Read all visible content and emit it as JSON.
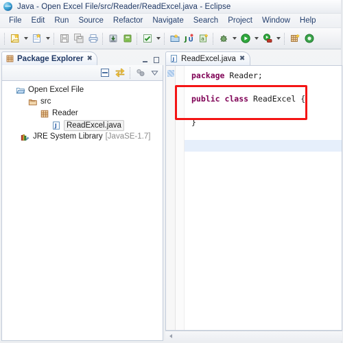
{
  "window": {
    "title": "Java - Open Excel File/src/Reader/ReadExcel.java - Eclipse",
    "app_icon": "eclipse-ball-icon"
  },
  "menubar": {
    "items": [
      {
        "label": "File"
      },
      {
        "label": "Edit"
      },
      {
        "label": "Run"
      },
      {
        "label": "Source"
      },
      {
        "label": "Refactor"
      },
      {
        "label": "Navigate"
      },
      {
        "label": "Search"
      },
      {
        "label": "Project"
      },
      {
        "label": "Window"
      },
      {
        "label": "Help"
      }
    ]
  },
  "toolbar": {
    "groups": [
      {
        "buttons": [
          {
            "name": "new-wizard-icon",
            "dropdown": true
          },
          {
            "name": "new-java-class-icon",
            "dropdown": true
          }
        ]
      },
      {
        "buttons": [
          {
            "name": "save-icon",
            "dropdown": false
          },
          {
            "name": "save-all-icon",
            "dropdown": false
          },
          {
            "name": "print-icon",
            "dropdown": false
          }
        ]
      },
      {
        "buttons": [
          {
            "name": "import-icon",
            "dropdown": false
          },
          {
            "name": "export-icon",
            "dropdown": false
          }
        ]
      },
      {
        "buttons": [
          {
            "name": "build-all-icon",
            "dropdown": true
          }
        ]
      },
      {
        "buttons": [
          {
            "name": "open-type-icon",
            "dropdown": false
          },
          {
            "name": "new-junit-test-icon",
            "dropdown": false
          },
          {
            "name": "search-icon",
            "dropdown": false
          }
        ]
      },
      {
        "buttons": [
          {
            "name": "debug-icon",
            "dropdown": true
          },
          {
            "name": "run-icon",
            "dropdown": true
          },
          {
            "name": "run-external-tools-icon",
            "dropdown": true
          }
        ]
      },
      {
        "buttons": [
          {
            "name": "new-java-project-icon",
            "dropdown": false
          },
          {
            "name": "new-package-icon",
            "dropdown": false
          }
        ]
      }
    ]
  },
  "package_explorer": {
    "tab_label": "Package Explorer",
    "close_glyph": "✖",
    "view_controls": [
      {
        "name": "minimize-view-button",
        "glyph": ""
      },
      {
        "name": "maximize-view-button",
        "glyph": ""
      }
    ],
    "toolbar_buttons": [
      {
        "name": "collapse-all-icon"
      },
      {
        "name": "link-with-editor-icon"
      },
      {
        "name": "view-menu-icon"
      },
      {
        "name": "view-menu-chevron-icon"
      }
    ],
    "tree": [
      {
        "label": "Open Excel File",
        "icon": "project-folder-icon",
        "depth": 0,
        "selected": false,
        "suffix": ""
      },
      {
        "label": "src",
        "icon": "source-folder-icon",
        "depth": 1,
        "selected": false,
        "suffix": ""
      },
      {
        "label": "Reader",
        "icon": "package-icon",
        "depth": 2,
        "selected": false,
        "suffix": ""
      },
      {
        "label": "ReadExcel.java",
        "icon": "java-file-icon",
        "depth": 3,
        "selected": true,
        "suffix": ""
      },
      {
        "label": "JRE System Library",
        "icon": "library-icon",
        "depth": 1,
        "selected": false,
        "suffix": "[JavaSE-1.7]"
      }
    ]
  },
  "editor": {
    "tab_label": "ReadExcel.java",
    "tab_icon": "java-file-icon",
    "close_glyph": "✖",
    "gutter_marker": "bookmark-marker-icon",
    "annotation": {
      "name": "red-highlight-box",
      "color": "#f41414"
    },
    "lines": [
      {
        "tokens": [
          {
            "t": "package",
            "k": true
          },
          {
            "t": " Reader;",
            "k": false
          }
        ],
        "highlight": false
      },
      {
        "tokens": [],
        "highlight": false
      },
      {
        "tokens": [
          {
            "t": "public class",
            "k": true
          },
          {
            "t": " ReadExcel {",
            "k": false
          }
        ],
        "highlight": false
      },
      {
        "tokens": [],
        "highlight": false
      },
      {
        "tokens": [
          {
            "t": "}",
            "k": false
          }
        ],
        "highlight": false
      },
      {
        "tokens": [],
        "highlight": false
      },
      {
        "tokens": [],
        "highlight": true
      }
    ],
    "scrollbar": {
      "name": "horizontal-scrollbar",
      "left_arrow": "scroll-left-arrow-icon"
    }
  },
  "colors": {
    "keyword": "#7f0055",
    "text": "#1b1b1b",
    "annotation": "#f41414",
    "title": "#1f3864",
    "current_line": "#e6effb"
  }
}
